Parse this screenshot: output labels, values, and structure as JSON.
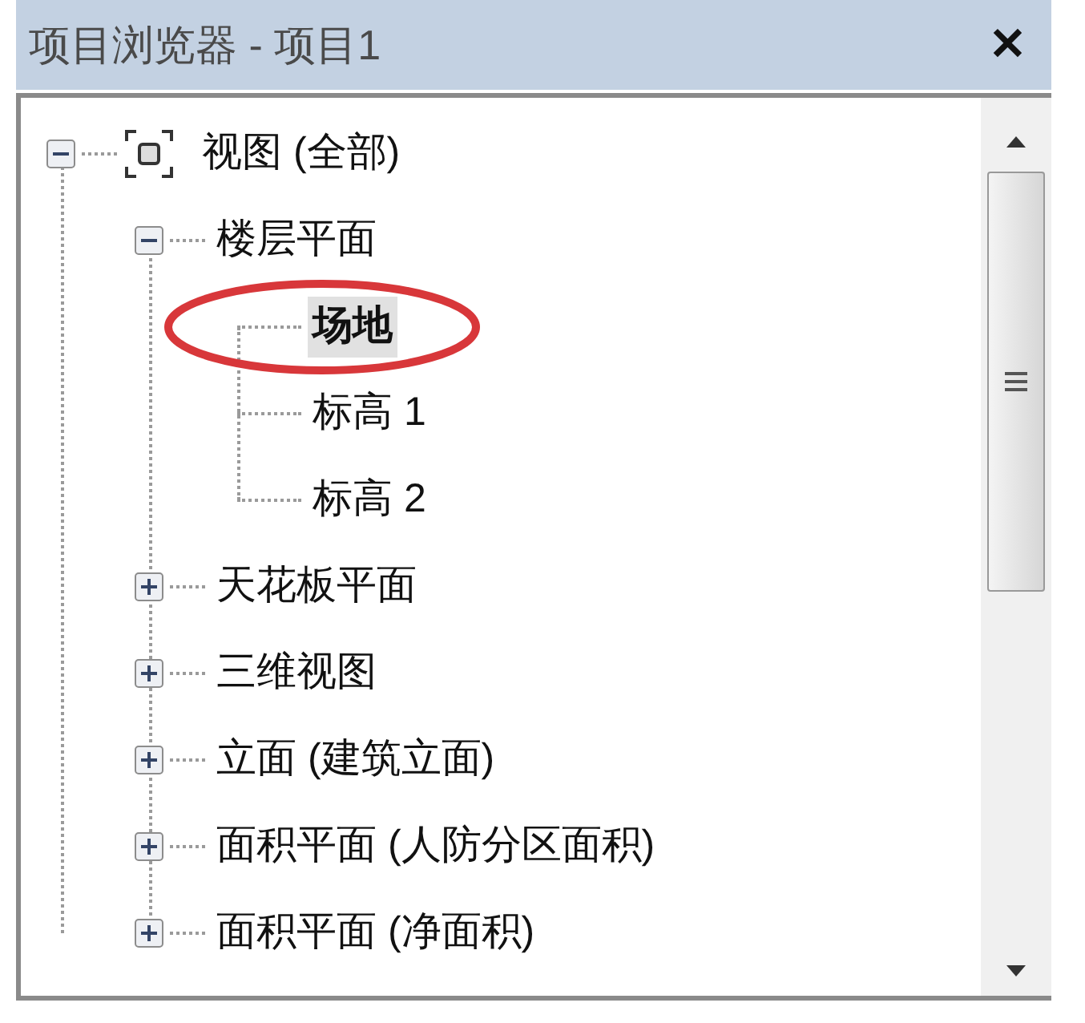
{
  "window": {
    "title": "项目浏览器 - 项目1",
    "close": "✕"
  },
  "tree": [
    {
      "label": "视图 (全部)",
      "kind": "views",
      "expanded": true,
      "children": [
        {
          "label": "楼层平面",
          "expanded": true,
          "children": [
            {
              "label": "场地",
              "selected": true,
              "circled": true
            },
            {
              "label": "标高 1",
              "selected": false,
              "circled": false
            },
            {
              "label": "标高 2",
              "selected": false,
              "circled": false
            }
          ]
        },
        {
          "label": "天花板平面",
          "expanded": false
        },
        {
          "label": "三维视图",
          "expanded": false
        },
        {
          "label": "立面 (建筑立面)",
          "expanded": false
        },
        {
          "label": "面积平面 (人防分区面积)",
          "expanded": false
        },
        {
          "label": "面积平面 (净面积)",
          "expanded": false
        }
      ]
    }
  ]
}
